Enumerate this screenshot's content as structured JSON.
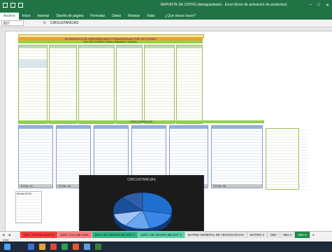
{
  "window": {
    "title": "REPORTE DE CNTRS (Autoguardado) - Excel (Error de activación de productos)",
    "controls": [
      "–",
      "□",
      "✕"
    ]
  },
  "ribbon": {
    "tabs": [
      "Archivo",
      "Inicio",
      "Insertar",
      "Diseño de página",
      "Fórmulas",
      "Datos",
      "Revisar",
      "Vista"
    ],
    "active": 0,
    "tell_me": "¿Qué desea hacer?"
  },
  "formula_bar": {
    "cell": "B27",
    "fx": "fx",
    "value": "CIRCUSTANCIAS"
  },
  "sheet": {
    "top_banner": "ESTADISTICA DE ENFERMEDADES TRANSMITIDAS POR VECTORES",
    "sub_banner": "DIA SECTORES ZONA URBANA Y RURAL",
    "mid_banner": "CIRCUSTANCIAS"
  },
  "blue_tables": [
    {
      "total": "TOTAL  21"
    },
    {
      "total": "TOTAL  18"
    },
    {
      "total": "TOTAL  11"
    },
    {
      "total": "TOTAL  14"
    },
    {
      "total": "TOTAL  40"
    },
    {
      "total": "TOTAL  35"
    }
  ],
  "summary": {
    "label": "MUNICIPIO"
  },
  "chart": {
    "title": "CIRCUSTANCIAS"
  },
  "chart_data": {
    "type": "pie",
    "title": "CIRCUSTANCIAS",
    "slices": [
      {
        "value": 28,
        "color": "#1f6fd1"
      },
      {
        "value": 18,
        "color": "#3a87e8"
      },
      {
        "value": 14,
        "color": "#6aa6f0"
      },
      {
        "value": 12,
        "color": "#9ec5f5"
      },
      {
        "value": 16,
        "color": "#1a4f99"
      },
      {
        "value": 12,
        "color": "#2f5fa8"
      }
    ]
  },
  "sheet_tabs": {
    "nav": [
      "◀",
      "▶",
      "…"
    ],
    "tabs": [
      {
        "label": "DIST. CNTRS DEPTO",
        "color": "#ff3b3b"
      },
      {
        "label": "DIST. CUA DE OBS",
        "color": "#ff7d7d"
      },
      {
        "label": "DIST. DE GRUPO DE EST 1",
        "color": "#2eb886"
      },
      {
        "label": "DIST. DE GRUPO DE EST 2",
        "color": "#5ad0a8"
      },
      {
        "label": "MATRIZ GENERAL DE TECNOLOGIAS",
        "color": "#e6e6e6"
      },
      {
        "label": "MATRIZ 2",
        "color": "#e6e6e6"
      },
      {
        "label": "OBJ",
        "color": "#e6e6e6"
      },
      {
        "label": "OBJ 2",
        "color": "#e6e6e6"
      },
      {
        "label": "OBJ 3",
        "color": "#1e8a4a"
      }
    ],
    "more": "⊕"
  },
  "status": {
    "text": "Listo"
  }
}
